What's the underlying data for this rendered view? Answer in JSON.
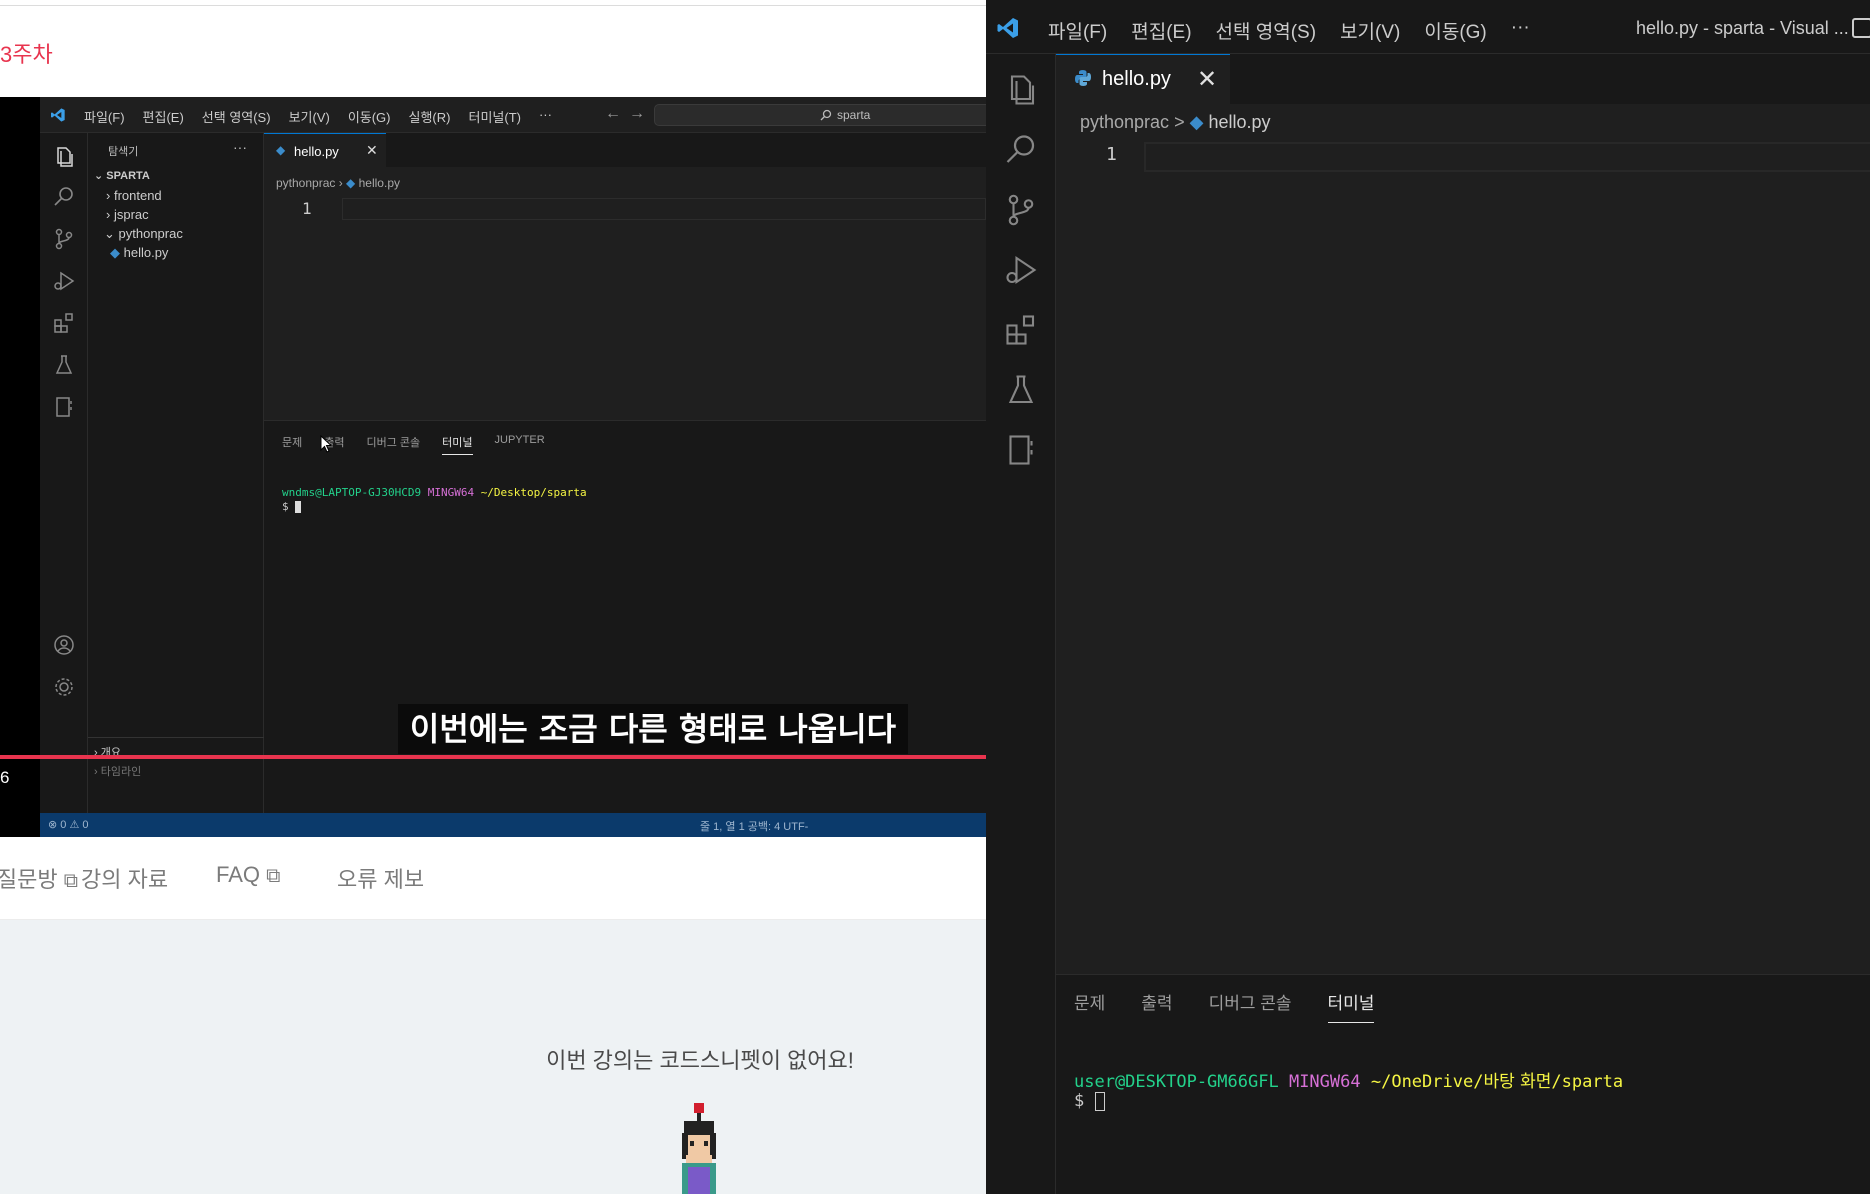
{
  "lesson_page": {
    "week_title": "3주차",
    "links": [
      "기이한 질문방",
      "강의 자료",
      "FAQ",
      "오류 제보"
    ],
    "video_time": "6",
    "no_snippet_message": "이번 강의는 코드스니펫이 없어요!"
  },
  "video": {
    "caption": "이번에는 조금 다른 형태로 나옵니다",
    "menu": [
      "파일(F)",
      "편집(E)",
      "선택 영역(S)",
      "보기(V)",
      "이동(G)",
      "실행(R)",
      "터미널(T)",
      "···"
    ],
    "search_placeholder": "sparta",
    "explorer_title": "탐색기",
    "explorer_more": "···",
    "tree": {
      "root": "SPARTA",
      "items": [
        "frontend",
        "jsprac",
        "pythonprac",
        "hello.py"
      ]
    },
    "outline_label": "개요",
    "timeline_label": "타임라인",
    "tab_label": "hello.py",
    "breadcrumb_folder": "pythonprac",
    "breadcrumb_file": "hello.py",
    "line_number": "1",
    "panel_tabs": [
      "문제",
      "출력",
      "디버그 콘솔",
      "터미널",
      "JUPYTER"
    ],
    "terminal": {
      "user": "wndms@LAPTOP-GJ30HCD9",
      "shell": "MINGW64",
      "path": "~/Desktop/sparta",
      "prompt": "$"
    },
    "status_left": "⊗ 0 ⚠ 0",
    "status_right": "줄 1, 열 1    공백: 4    UTF-"
  },
  "vscode": {
    "menu": [
      "파일(F)",
      "편집(E)",
      "선택 영역(S)",
      "보기(V)",
      "이동(G)",
      "···"
    ],
    "window_title": "hello.py - sparta - Visual ...",
    "tab_label": "hello.py",
    "tab_close": "✕",
    "breadcrumb_folder": "pythonprac",
    "breadcrumb_sep": ">",
    "breadcrumb_file": "hello.py",
    "line_number": "1",
    "panel_tabs": [
      "문제",
      "출력",
      "디버그 콘솔",
      "터미널"
    ],
    "terminal": {
      "user": "user@DESKTOP-GM66GFL",
      "shell": "MINGW64",
      "path_a": "~/OneDrive/",
      "path_b": "바탕 화면",
      "path_c": "/sparta",
      "prompt": "$"
    }
  },
  "colors": {
    "accent_red": "#e8344e",
    "vscode_bg": "#1f1f1f",
    "vscode_blue": "#0078d4",
    "python_blue": "#3b8ccb",
    "terminal_green": "#23d18b",
    "terminal_magenta": "#d670d6",
    "terminal_yellow": "#f5f543"
  }
}
